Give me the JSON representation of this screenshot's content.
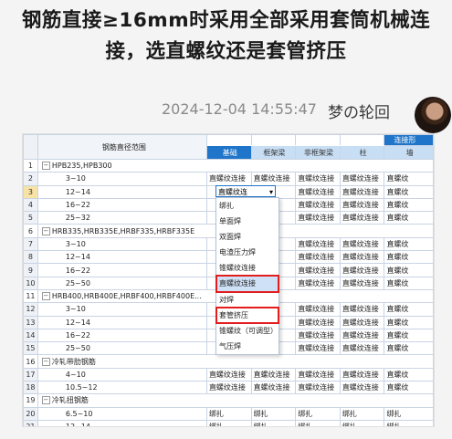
{
  "post": {
    "title_line1": "钢筋直接≥16mm时采用全部采用套筒机械连",
    "title_line2": "接，选直螺纹还是套管挤压",
    "timestamp": "2024-12-04 14:55:47",
    "author": "梦の轮回"
  },
  "table": {
    "header_group": "连接形",
    "header_range": "钢筋直径范围",
    "col_headers": [
      "基础",
      "框架梁",
      "非框架梁",
      "柱",
      "墙"
    ],
    "rows": [
      {
        "n": "1",
        "type": "group",
        "toggle": "−",
        "label": "HPB235,HPB300",
        "cells": []
      },
      {
        "n": "2",
        "type": "child",
        "label": "3~10",
        "cells": [
          "直螺纹连接",
          "直螺纹连接",
          "直螺纹连接",
          "直螺纹连接",
          "直螺纹"
        ]
      },
      {
        "n": "3",
        "type": "child",
        "label": "12~14",
        "cells": [
          "",
          "纹连接",
          "直螺纹连接",
          "直螺纹连接",
          "直螺纹"
        ],
        "selected": true
      },
      {
        "n": "4",
        "type": "child",
        "label": "16~22",
        "cells": [
          "",
          "纹连接",
          "直螺纹连接",
          "直螺纹连接",
          "直螺纹"
        ]
      },
      {
        "n": "5",
        "type": "child",
        "label": "25~32",
        "cells": [
          "",
          "纹连接",
          "直螺纹连接",
          "直螺纹连接",
          "直螺纹"
        ]
      },
      {
        "n": "6",
        "type": "group",
        "toggle": "−",
        "label": "HRB335,HRB335E,HRBF335,HRBF335E",
        "cells": []
      },
      {
        "n": "7",
        "type": "child",
        "label": "3~10",
        "cells": [
          "",
          "纹连接",
          "直螺纹连接",
          "直螺纹连接",
          "直螺纹"
        ]
      },
      {
        "n": "8",
        "type": "child",
        "label": "12~14",
        "cells": [
          "",
          "纹连接",
          "直螺纹连接",
          "直螺纹连接",
          "直螺纹"
        ]
      },
      {
        "n": "9",
        "type": "child",
        "label": "16~22",
        "cells": [
          "",
          "纹连接",
          "直螺纹连接",
          "直螺纹连接",
          "直螺纹"
        ]
      },
      {
        "n": "10",
        "type": "child",
        "label": "25~50",
        "cells": [
          "",
          "纹连接",
          "直螺纹连接",
          "直螺纹连接",
          "直螺纹"
        ]
      },
      {
        "n": "11",
        "type": "group",
        "toggle": "−",
        "label": "HRB400,HRB400E,HRBF400,HRBF400E...",
        "cells": []
      },
      {
        "n": "12",
        "type": "child",
        "label": "3~10",
        "cells": [
          "",
          "纹连接",
          "直螺纹连接",
          "直螺纹连接",
          "直螺纹"
        ]
      },
      {
        "n": "13",
        "type": "child",
        "label": "12~14",
        "cells": [
          "",
          "纹连接",
          "直螺纹连接",
          "直螺纹连接",
          "直螺纹"
        ]
      },
      {
        "n": "14",
        "type": "child",
        "label": "16~22",
        "cells": [
          "",
          "纹连接",
          "直螺纹连接",
          "直螺纹连接",
          "直螺纹"
        ]
      },
      {
        "n": "15",
        "type": "child",
        "label": "25~50",
        "cells": [
          "",
          "纹连接",
          "直螺纹连接",
          "直螺纹连接",
          "直螺纹"
        ]
      },
      {
        "n": "16",
        "type": "group",
        "toggle": "−",
        "label": "冷轧带肋钢筋",
        "cells": []
      },
      {
        "n": "17",
        "type": "child",
        "label": "4~10",
        "cells": [
          "直螺纹连接",
          "直螺纹连接",
          "直螺纹连接",
          "直螺纹连接",
          "直螺纹"
        ]
      },
      {
        "n": "18",
        "type": "child",
        "label": "10.5~12",
        "cells": [
          "直螺纹连接",
          "直螺纹连接",
          "直螺纹连接",
          "直螺纹连接",
          "直螺纹"
        ]
      },
      {
        "n": "19",
        "type": "group",
        "toggle": "−",
        "label": "冷轧扭钢筋",
        "cells": []
      },
      {
        "n": "20",
        "type": "child",
        "label": "6.5~10",
        "cells": [
          "绑扎",
          "绑扎",
          "绑扎",
          "绑扎",
          "绑扎"
        ]
      },
      {
        "n": "21",
        "type": "child",
        "label": "12~14",
        "cells": [
          "绑扎",
          "绑扎",
          "绑扎",
          "绑扎",
          "绑扎"
        ]
      }
    ]
  },
  "dropdown": {
    "value": "直螺纹连",
    "arrow": "▾",
    "options": [
      "绑扎",
      "单面焊",
      "双面焊",
      "电渣压力焊",
      "锥螺纹连接",
      "直螺纹连接",
      "对焊",
      "套管挤压",
      "锥螺纹（可调型）",
      "气压焊"
    ]
  },
  "colors": {
    "header_blue": "#1f75c9",
    "header_light": "#c8def4",
    "highlight_red": "#e21d1d"
  }
}
